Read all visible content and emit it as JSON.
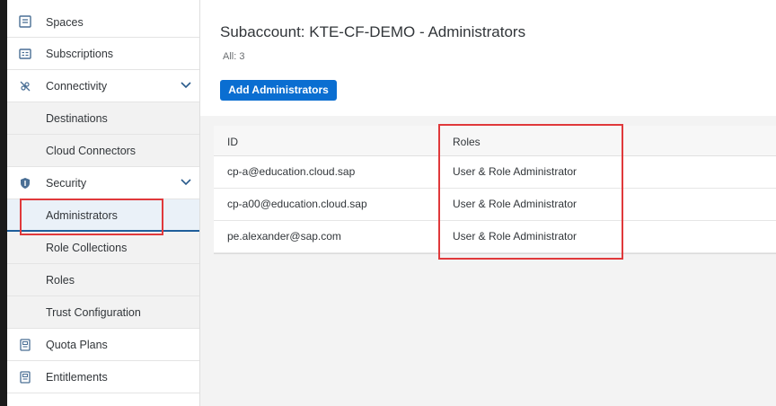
{
  "sidebar": {
    "items": [
      {
        "label": "Spaces",
        "icon": "spaces-icon"
      },
      {
        "label": "Subscriptions",
        "icon": "subscriptions-icon"
      },
      {
        "label": "Connectivity",
        "icon": "connectivity-icon",
        "expandable": true
      },
      {
        "label": "Destinations"
      },
      {
        "label": "Cloud Connectors"
      },
      {
        "label": "Security",
        "icon": "shield-icon",
        "expandable": true
      },
      {
        "label": "Administrators",
        "selected": true
      },
      {
        "label": "Role Collections"
      },
      {
        "label": "Roles"
      },
      {
        "label": "Trust Configuration"
      },
      {
        "label": "Quota Plans",
        "icon": "quota-plans-icon"
      },
      {
        "label": "Entitlements",
        "icon": "entitlements-icon"
      }
    ]
  },
  "main": {
    "title": "Subaccount: KTE-CF-DEMO - Administrators",
    "count": "All: 3",
    "add_button": "Add Administrators"
  },
  "table": {
    "headers": [
      "ID",
      "Roles"
    ],
    "rows": [
      [
        "cp-a@education.cloud.sap",
        "User & Role Administrator"
      ],
      [
        "cp-a00@education.cloud.sap",
        "User & Role Administrator"
      ],
      [
        "pe.alexander@sap.com",
        "User & Role Administrator"
      ]
    ]
  },
  "colors": {
    "accent": "#0a6ed1",
    "highlight": "#e0393b",
    "icon": "#4a6f95",
    "selected_bg": "#eaf1f8"
  }
}
